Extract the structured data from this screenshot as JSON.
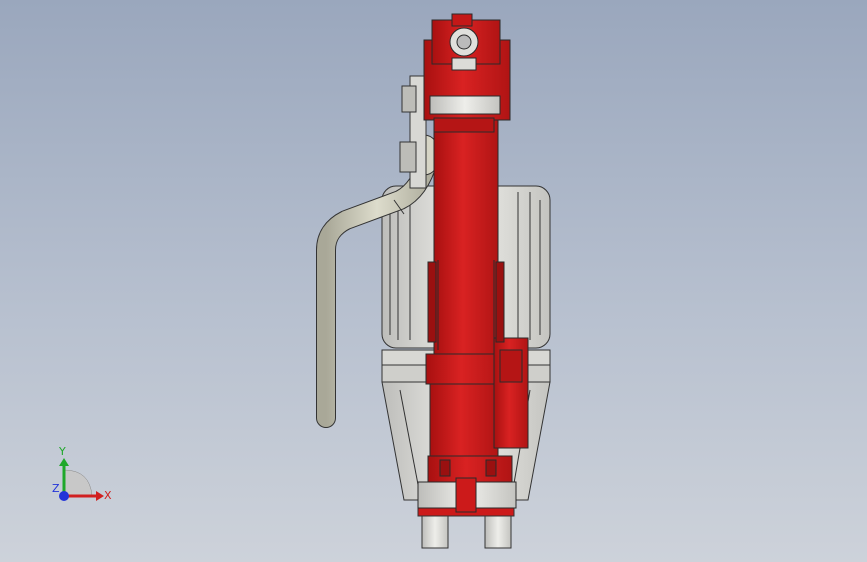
{
  "viewport": {
    "background_top": "#9aa7bd",
    "background_bottom": "#cdd2da"
  },
  "model": {
    "primary_color": "#cc1a1a",
    "secondary_color": "#e8e8e4",
    "outline_color": "#2a2a2a",
    "hose_color": "#c9c8b8"
  },
  "triad": {
    "x_label": "X",
    "y_label": "Y",
    "z_label": "Z",
    "x_color": "#d12020",
    "y_color": "#1fa82a",
    "z_color": "#2234d8"
  }
}
